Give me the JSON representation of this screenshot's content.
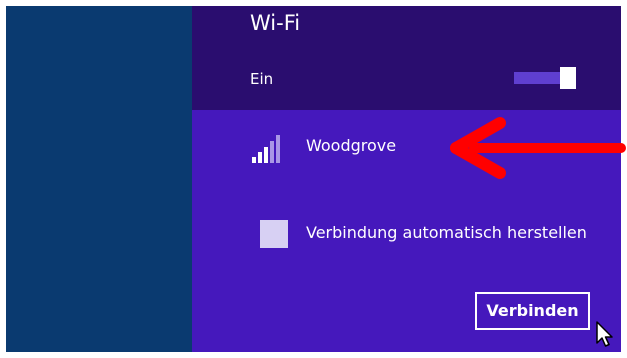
{
  "wifi_panel": {
    "title": "Wi-Fi",
    "toggle": {
      "label": "Ein",
      "state": "on"
    },
    "network": {
      "name": "Woodgrove",
      "icon": "wifi-signal-icon"
    },
    "auto_connect": {
      "label": "Verbindung automatisch herstellen",
      "checked": false
    },
    "connect_button": {
      "label": "Verbinden"
    }
  },
  "annotation": {
    "icon": "red-arrow-icon",
    "color": "#ff0000"
  },
  "cursor": {
    "icon": "mouse-cursor-icon"
  },
  "colors": {
    "left_pane": "#0a3a70",
    "panel_header": "#2a0d6f",
    "panel_body": "#4518bc",
    "toggle_track": "#5f3fd0",
    "checkbox": "#d7d0f3",
    "text": "#ffffff"
  }
}
